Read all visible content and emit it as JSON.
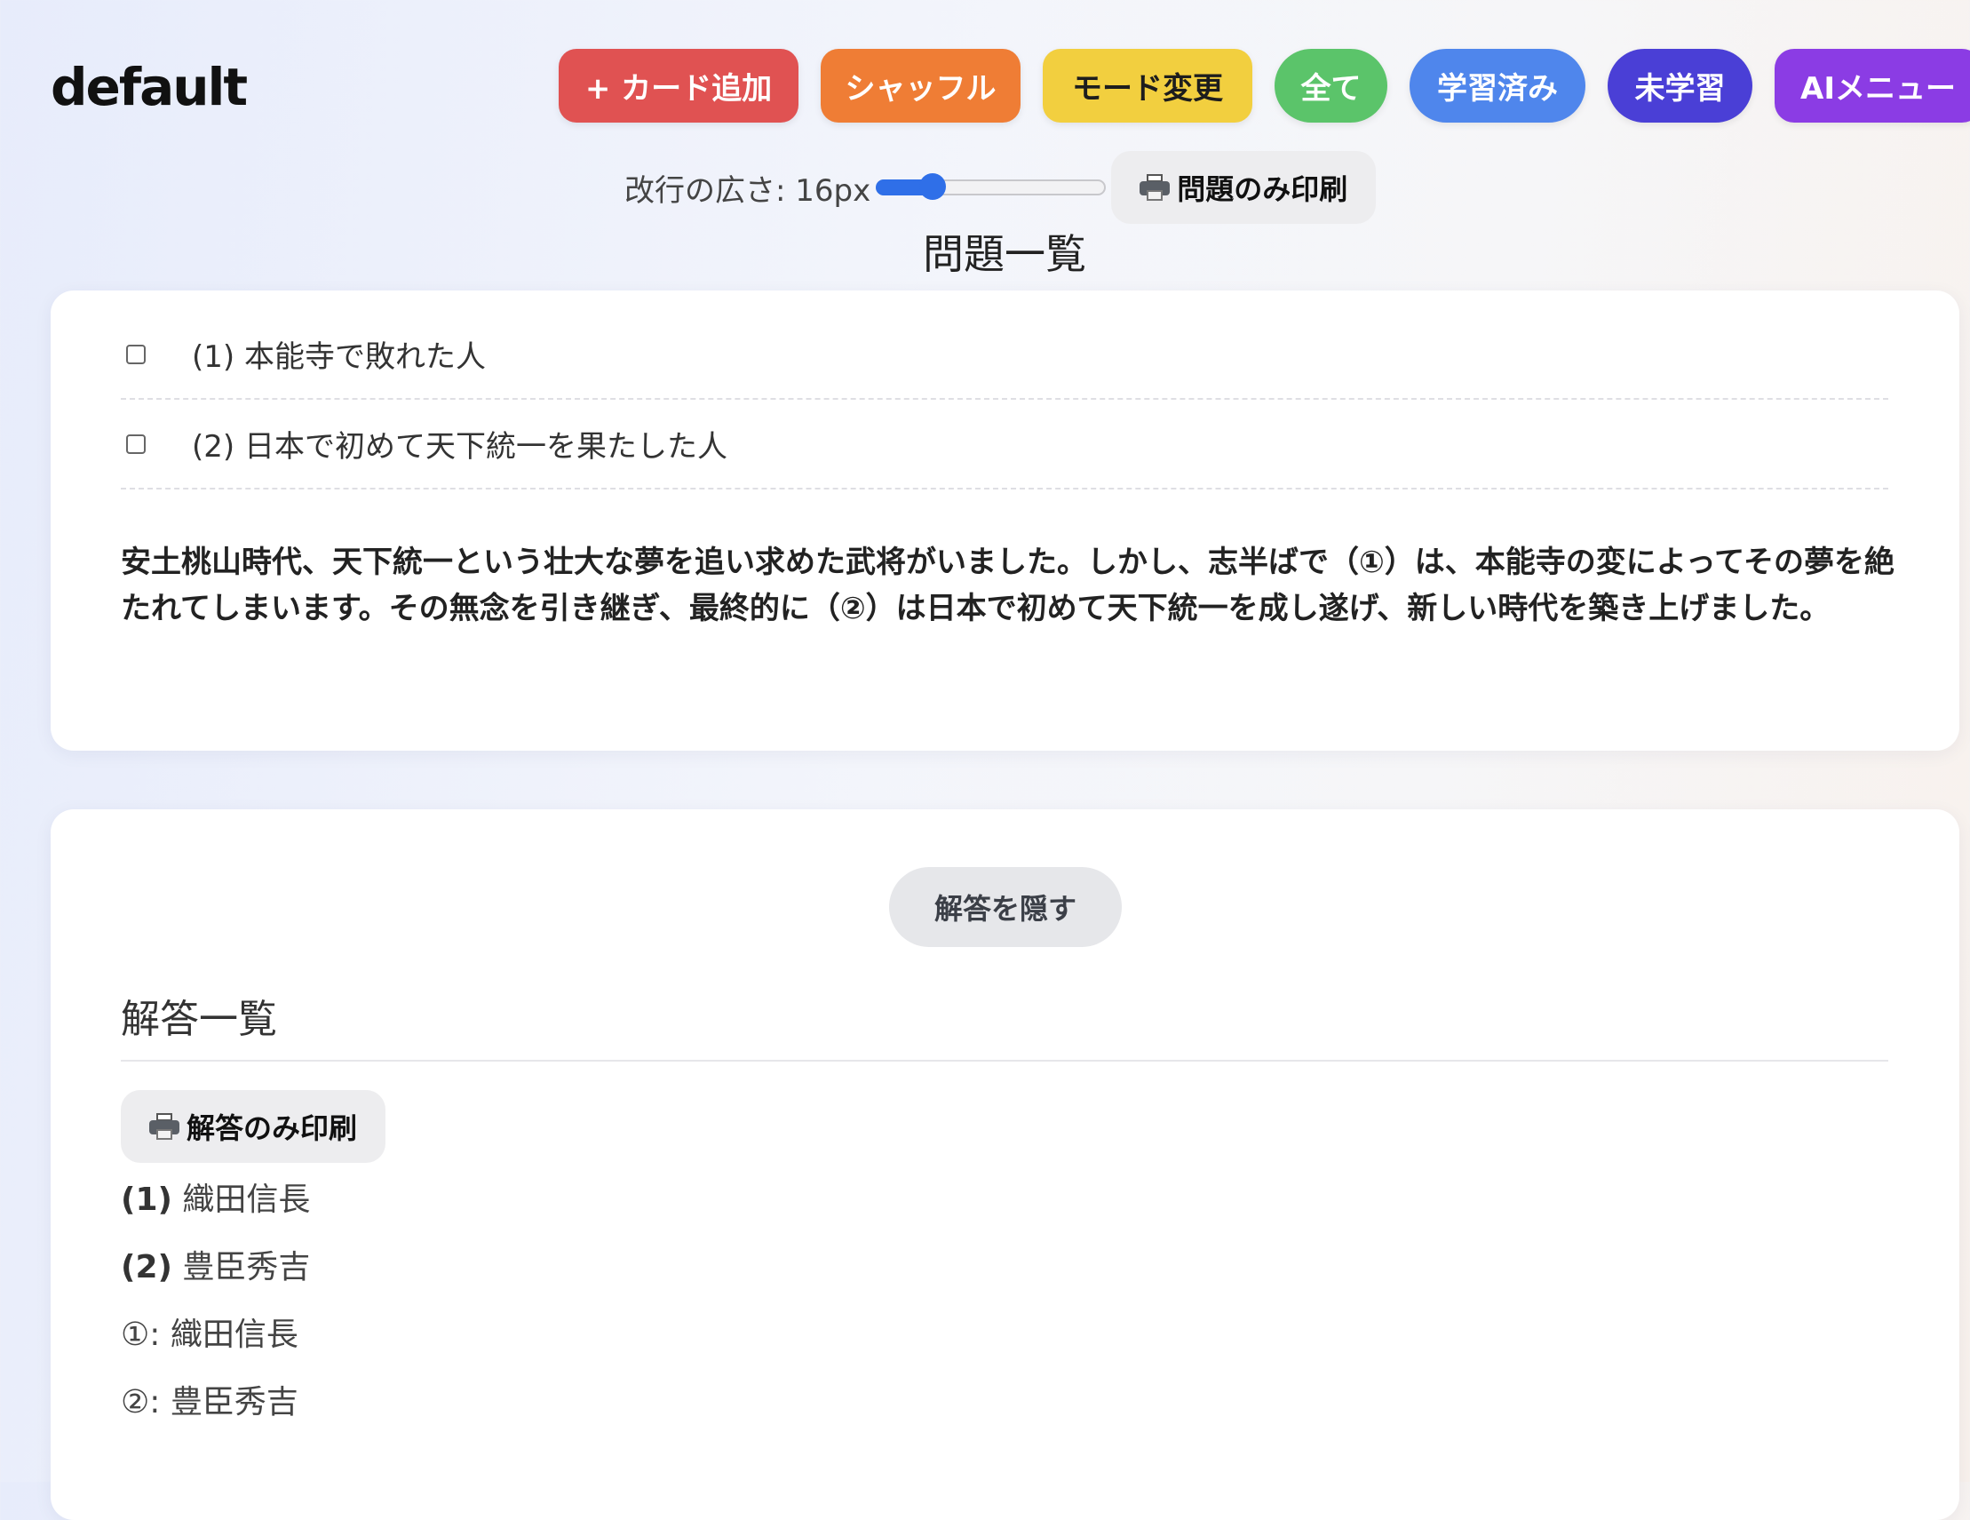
{
  "header": {
    "brand": "default",
    "buttons": {
      "add_card": "+ カード追加",
      "shuffle": "シャッフル",
      "mode_change": "モード変更",
      "all": "全て",
      "learned": "学習済み",
      "unlearned": "未学習",
      "ai_menu": "AIメニュー"
    },
    "colors": {
      "add_card": "#e05252",
      "shuffle": "#ef7d35",
      "mode_change": "#f2cf3f",
      "all": "#5bc46a",
      "learned": "#4f86ec",
      "unlearned": "#4a3fd6",
      "ai_menu": "#8b3ce4"
    }
  },
  "controls": {
    "line_spacing_label": "改行の広さ: 16px",
    "line_spacing_fraction": 0.2,
    "print_questions_label": "問題のみ印刷",
    "print_icon": "printer-icon"
  },
  "questions": {
    "title": "問題一覧",
    "items": [
      {
        "text": "(1) 本能寺で敗れた人",
        "checked": false
      },
      {
        "text": "(2) 日本で初めて天下統一を果たした人",
        "checked": false
      }
    ],
    "passage": "安土桃山時代、天下統一という壮大な夢を追い求めた武将がいました。しかし、志半ばで（①）は、本能寺の変によってその夢を絶たれてしまいます。その無念を引き継ぎ、最終的に（②）は日本で初めて天下統一を成し遂げ、新しい時代を築き上げました。"
  },
  "answers": {
    "hide_button": "解答を隠す",
    "heading": "解答一覧",
    "print_answers_label": "解答のみ印刷",
    "items": [
      {
        "label": "(1)",
        "value": " 織田信長"
      },
      {
        "label": "(2)",
        "value": " 豊臣秀吉"
      },
      {
        "label": "①:",
        "value": " 織田信長"
      },
      {
        "label": "②:",
        "value": " 豊臣秀吉"
      }
    ]
  }
}
